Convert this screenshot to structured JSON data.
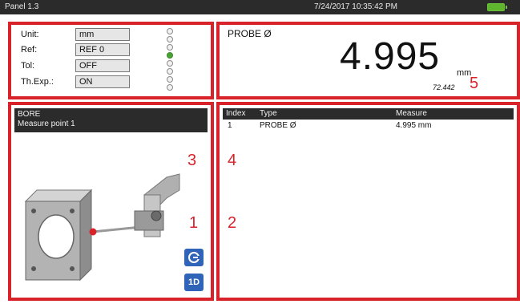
{
  "titlebar": {
    "title": "Panel 1.3",
    "datetime": "7/24/2017 10:35:42 PM",
    "battery_icon": "battery-full-icon",
    "battery_color": "#5fb52e"
  },
  "settings": {
    "rows": [
      {
        "label": "Unit:",
        "value": "mm"
      },
      {
        "label": "Ref:",
        "value": "REF 0"
      },
      {
        "label": "Tol:",
        "value": "OFF"
      },
      {
        "label": "Th.Exp.:",
        "value": "ON"
      }
    ],
    "led_count": 6,
    "led_active_index": 3,
    "led_active_color": "#4aa336"
  },
  "probe": {
    "title": "PROBE Ø",
    "value": "4.995",
    "unit": "mm",
    "sub_value": "72.442"
  },
  "callouts": {
    "c1": "1",
    "c2": "2",
    "c3": "3",
    "c4": "4",
    "c5": "5",
    "color": "#d8232a"
  },
  "diagram": {
    "header_line1": "BORE",
    "header_line2": "Measure point 1",
    "button_probe_icon": "probe-connect-icon",
    "button_mode_label": "1D"
  },
  "table": {
    "headers": [
      "Index",
      "Type",
      "Measure"
    ],
    "rows": [
      {
        "index": "1",
        "type": "PROBE Ø",
        "measure": "4.995 mm"
      }
    ]
  }
}
